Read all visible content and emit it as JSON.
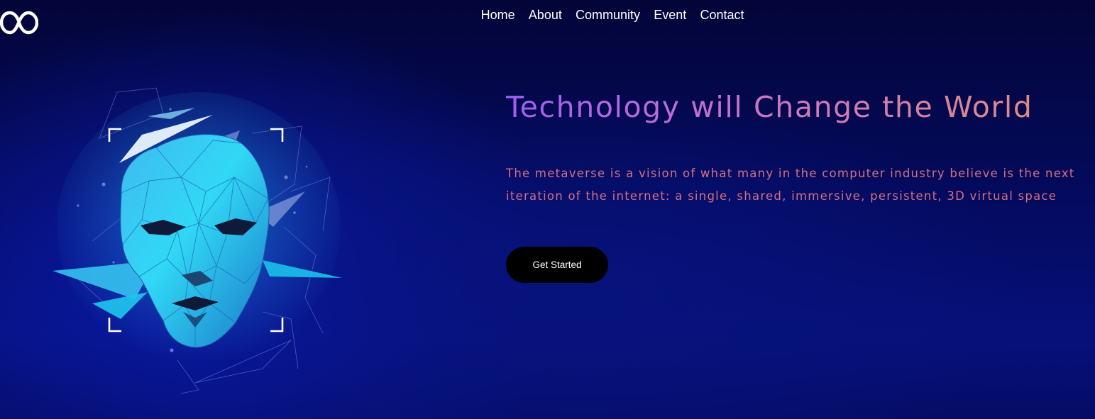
{
  "brand": {
    "logo_icon": "infinity-icon"
  },
  "nav": {
    "items": [
      {
        "label": "Home"
      },
      {
        "label": "About"
      },
      {
        "label": "Community"
      },
      {
        "label": "Event"
      },
      {
        "label": "Contact"
      }
    ]
  },
  "hero": {
    "image_icon": "lowpoly-face-illustration",
    "title": "Technology will Change the World",
    "description": "The metaverse is a vision of what many in the computer industry believe is the next iteration of the internet: a single, shared, immersive, persistent, 3D virtual space",
    "cta_label": "Get Started"
  },
  "colors": {
    "background": "#040a5c",
    "title_gradient_start": "#a05ef3",
    "title_gradient_end": "#df8c84",
    "description": "#d6707f",
    "button_bg": "#000000",
    "face_primary": "#29a7e8"
  }
}
